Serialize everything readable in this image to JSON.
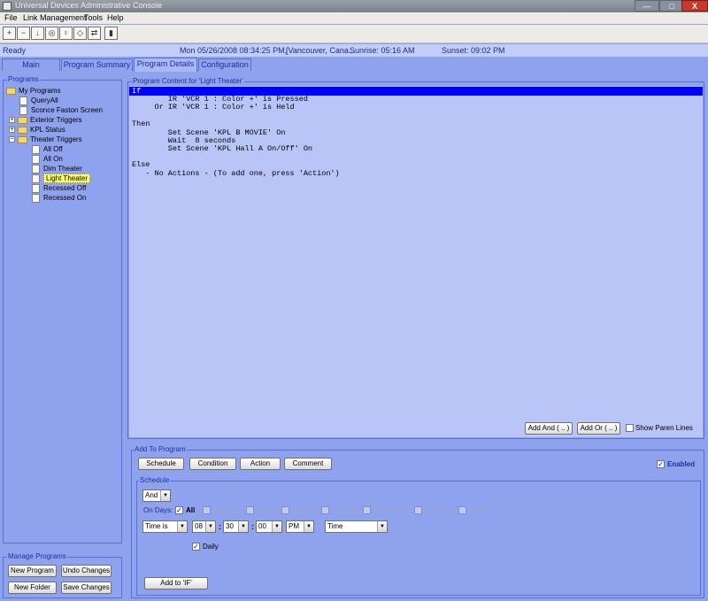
{
  "window": {
    "title": "Universal Devices Administrative Console",
    "minimize": "—",
    "maximize": "□",
    "close": "X"
  },
  "menu": [
    "File",
    "Link Management",
    "Tools",
    "Help"
  ],
  "toolbar": [
    "+",
    "−",
    "↓",
    "◎",
    "♀",
    "◇",
    "⇄",
    "▮"
  ],
  "status": {
    "left": "Ready",
    "datetime": "Mon 05/26/2008 08:34:25 PM,",
    "location": "[Vancouver, Cana...",
    "sunrise": "Sunrise: 05:16 AM",
    "sunset": "Sunset: 09:02 PM"
  },
  "tabs": [
    "Main",
    "Program Summary",
    "Program Details",
    "Configuration"
  ],
  "programs": {
    "legend": "Programs",
    "tree": [
      "My Programs",
      "QueryAll",
      "Sconce Faston Screen",
      "Exterior Triggers",
      "KPL Status",
      "Theater Triggers",
      "All Off",
      "All On",
      "Dim Theater",
      "Light Theater",
      "Recessed Off",
      "Recessed On"
    ]
  },
  "manage": {
    "legend": "Manage Programs",
    "new_program": "New Program",
    "undo_changes": "Undo Changes",
    "new_folder": "New Folder",
    "save_changes": "Save Changes"
  },
  "content": {
    "legend": "Program Content for 'Light Theater'",
    "lines": [
      "If",
      "        IR 'VCR 1 : Color +' is Pressed",
      "     Or IR 'VCR 1 : Color +' is Held",
      "",
      "Then",
      "        Set Scene 'KPL B MOVIE' On",
      "        Wait  8 seconds",
      "        Set Scene 'KPL Hall A On/Off' On",
      "",
      "Else",
      "   - No Actions - (To add one, press 'Action')"
    ],
    "add_and": "Add And ( .. )",
    "add_or": "Add Or ( .. )",
    "show_paren": "Show Paren Lines"
  },
  "add_to_program": {
    "legend": "Add To Program",
    "schedule": "Schedule",
    "condition": "Condition",
    "action": "Action",
    "comment": "Comment",
    "enabled": "Enabled"
  },
  "schedule": {
    "legend": "Schedule",
    "and_or": "And",
    "on_days": "On Days:",
    "all": "All",
    "days": [
      "Saturday",
      "Sunday",
      "Monday",
      "Tuesday",
      "Wednesday",
      "Thursday",
      "Friday"
    ],
    "time_is": "Time is",
    "hour": "08",
    "minute": "30",
    "second": "00",
    "ampm": "PM",
    "time_type": "Time",
    "daily": "Daily",
    "add_to_if": "Add to 'IF'",
    "check": "✓",
    "dropdown_arrow": "▼"
  },
  "colors": {
    "panel": "#8fa2ee",
    "editor": "#b9c5f7",
    "selection": "#0000ff",
    "highlight": "#ffff66"
  }
}
